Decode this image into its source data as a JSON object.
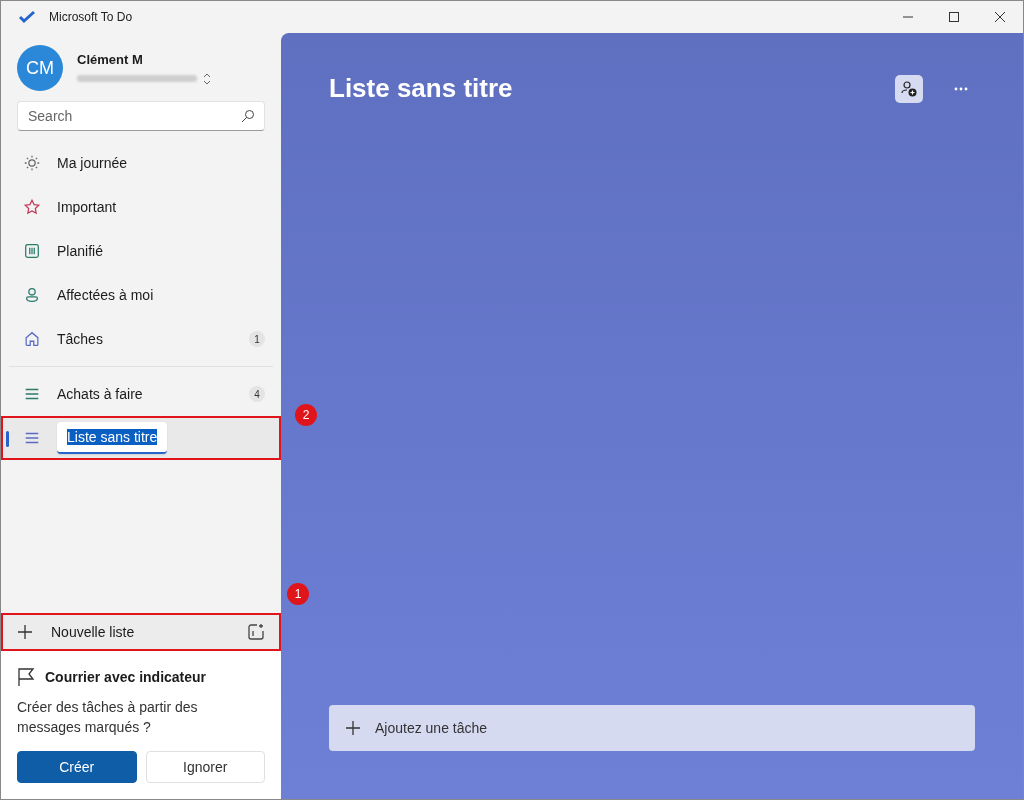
{
  "window": {
    "title": "Microsoft To Do"
  },
  "account": {
    "initials": "CM",
    "name": "Clément M"
  },
  "search": {
    "placeholder": "Search"
  },
  "nav_items": [
    {
      "label": "Ma journée"
    },
    {
      "label": "Important"
    },
    {
      "label": "Planifié"
    },
    {
      "label": "Affectées à moi"
    },
    {
      "label": "Tâches",
      "count": "1"
    }
  ],
  "lists": [
    {
      "label": "Achats à faire",
      "count": "4",
      "selected": false,
      "editing": false
    },
    {
      "label": "Liste sans titre",
      "selected": true,
      "editing": true,
      "callout": "2"
    }
  ],
  "new_list": {
    "label": "Nouvelle liste",
    "callout": "1"
  },
  "flagged_card": {
    "title": "Courrier avec indicateur",
    "text": "Créer des tâches à partir des messages marqués ?",
    "buttons": [
      {
        "label": "Créer",
        "kind": "primary"
      },
      {
        "label": "Ignorer",
        "kind": "secondary"
      }
    ]
  },
  "main": {
    "title": "Liste sans titre",
    "add_task": {
      "placeholder": "Ajoutez une tâche"
    }
  }
}
